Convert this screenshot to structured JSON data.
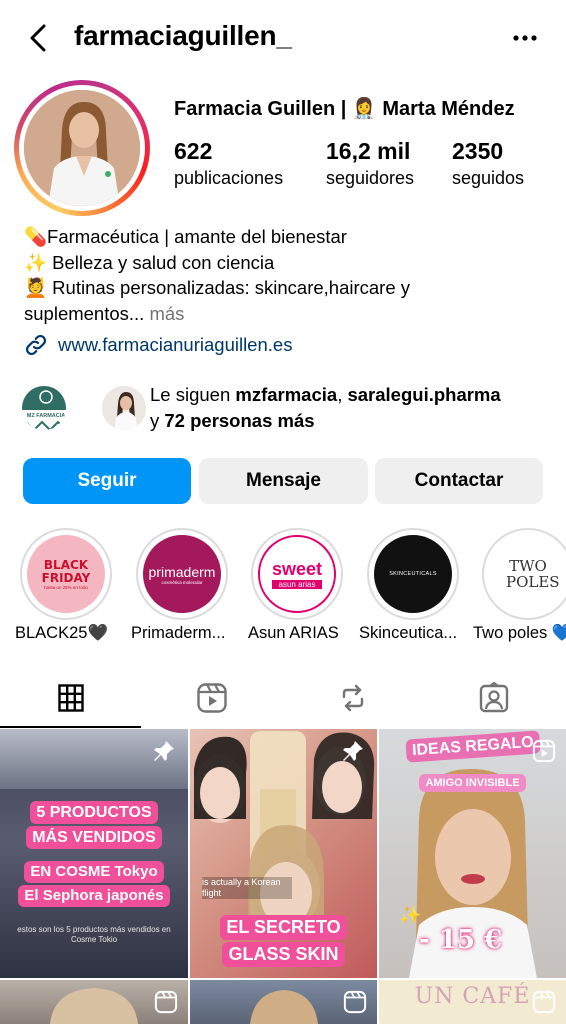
{
  "header": {
    "username": "farmaciaguillen_"
  },
  "profile": {
    "full_name": "Farmacia Guillen | 👩‍⚕️ Marta Méndez",
    "stats": [
      {
        "value": "622",
        "label": "publicaciones"
      },
      {
        "value": "16,2 mil",
        "label": "seguidores"
      },
      {
        "value": "2350",
        "label": "seguidos"
      }
    ],
    "bio": {
      "line1": "💊Farmacéutica | amante del bienestar",
      "line2": "✨ Belleza y salud con ciencia",
      "line3": "💆 Rutinas personalizadas: skincare,haircare y",
      "line4": "suplementos...",
      "more": " más"
    },
    "link": "www.farmacianuriaguillen.es"
  },
  "followed_by": {
    "prefix": "Le siguen ",
    "user1": "mzfarmacia",
    "sep": ", ",
    "user2": "saralegui.pharma",
    "y": "y ",
    "others": "72 personas más",
    "avatar1_text": "MZ FARMACIA"
  },
  "actions": {
    "follow": "Seguir",
    "message": "Mensaje",
    "contact": "Contactar"
  },
  "highlights": [
    {
      "label": "BLACK25🖤",
      "text": "BLACK FRIDAY",
      "sub": "hasta un 25% en todo"
    },
    {
      "label": "Primaderm...",
      "text": "primaderm",
      "sub": "cosmética molecular"
    },
    {
      "label": "Asun ARIAS",
      "text": "sweet",
      "sub": "asun arias"
    },
    {
      "label": "Skinceutica...",
      "text": "SKINCEUTICALS"
    },
    {
      "label": "Two poles 💙",
      "text": "TWO POLES"
    }
  ],
  "posts": [
    {
      "text1": "5 PRODUCTOS",
      "text2": "MÁS VENDIDOS",
      "text3": "EN COSME Tokyo",
      "text4": "El Sephora japonés",
      "caption": "estos son los 5 productos más vendidos en Cosme Tokio"
    },
    {
      "text1": "EL SECRETO",
      "text2": "GLASS SKIN",
      "caption": "is actually a Korean flight"
    },
    {
      "text1": "IDEAS REGALO",
      "text2": "AMIGO INVISIBLE",
      "text3": "- 15 €"
    },
    {
      "text1": "UN CAFÉ"
    }
  ],
  "colors": {
    "accent": "#0095f6",
    "link": "#00376b",
    "button_gray": "#efefef",
    "pink": "#f04f9a"
  }
}
